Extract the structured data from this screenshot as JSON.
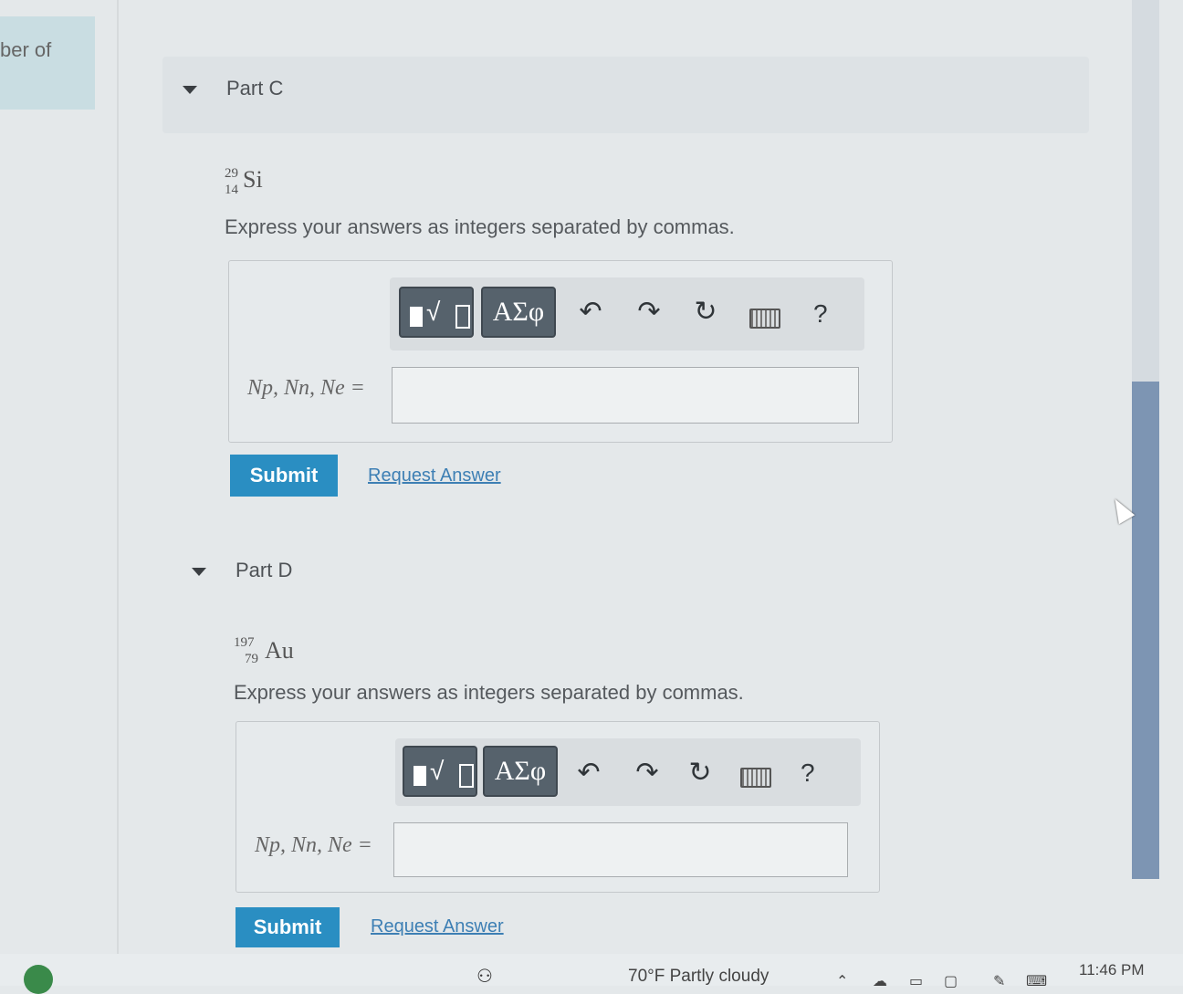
{
  "left_tab": {
    "text": "ber of"
  },
  "parts": [
    {
      "header": "Part C",
      "isotope": {
        "mass": "29",
        "atomic": "14",
        "symbol": "Si"
      },
      "instruction": "Express your answers as integers separated by commas.",
      "toolbar": {
        "symbols_label": "ΑΣφ",
        "help": "?"
      },
      "variable_label": "Np, Nn, Ne =",
      "answer_value": "",
      "submit_label": "Submit",
      "request_label": "Request Answer"
    },
    {
      "header": "Part D",
      "isotope": {
        "mass": "197",
        "atomic": "79",
        "symbol": "Au"
      },
      "instruction": "Express your answers as integers separated by commas.",
      "toolbar": {
        "symbols_label": "ΑΣφ",
        "help": "?"
      },
      "variable_label": "Np, Nn, Ne =",
      "answer_value": "",
      "submit_label": "Submit",
      "request_label": "Request Answer"
    }
  ],
  "icons": {
    "undo": "↶",
    "redo": "↷",
    "reset": "↻",
    "keyboard": "keyboard-icon",
    "templates": "templates-icon"
  },
  "taskbar": {
    "weather": "70°F Partly cloudy",
    "clock": "11:46 PM"
  },
  "colors": {
    "submit": "#2a8ec2",
    "link": "#3d7fb4",
    "toolbar_button": "#56626c",
    "scroll_thumb": "#7d95b3"
  }
}
